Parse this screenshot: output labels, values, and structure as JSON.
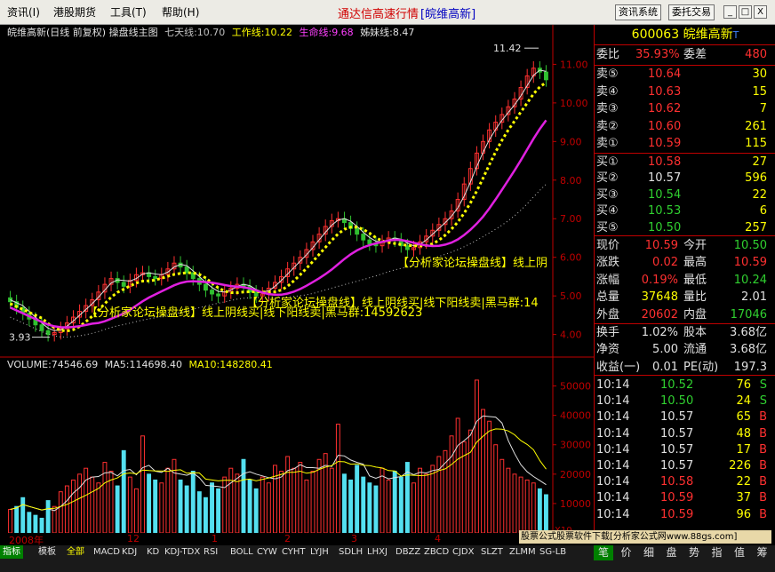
{
  "menu": {
    "items": [
      "资讯(I)",
      "港股期货",
      "工具(T)",
      "帮助(H)"
    ],
    "center_title": "通达信高速行情",
    "center_stock": "[皖维高新]",
    "btn_news": "资讯系统",
    "btn_trade": "委托交易",
    "win_min": "_",
    "win_max": "□",
    "win_close": "X"
  },
  "chart_header": {
    "name": "皖维高新(日线 前复权) 操盘线主图",
    "qitian": "七天线:10.70",
    "gongzuo": "工作线:10.22",
    "shengming": "生命线:9.68",
    "zimei": "姊妹线:8.47"
  },
  "chart_data": {
    "type": "candlestick+volume",
    "y_ticks": [
      "11.00",
      "10.00",
      "9.00",
      "8.00",
      "7.00",
      "6.00",
      "5.00",
      "4.00"
    ],
    "y_range": [
      3.6,
      11.7
    ],
    "high_label": "11.42",
    "low_label": "3.93",
    "volume_header": {
      "vol": "VOLUME:74546.69",
      "ma5": "MA5:114698.40",
      "ma10": "MA10:148280.41"
    },
    "volume_ticks": [
      "50000",
      "40000",
      "30000",
      "20000",
      "10000"
    ],
    "volume_unit": "X10",
    "volume_range": [
      0,
      55000
    ],
    "date_labels": [
      "2008年",
      "12",
      "1",
      "2",
      "3",
      "4"
    ],
    "annotation_1": "【分析家论坛操盘线】线上阴线买|线下阳线卖|黑马群:14592623",
    "annotation_2": "【分析家论坛操盘线】线上阴线买|线下阳线卖|黑马群:14",
    "annotation_3": "【分析家论坛操盘线】线上阴",
    "closes": [
      4.85,
      4.7,
      4.55,
      4.4,
      4.25,
      4.1,
      4.0,
      4.05,
      4.15,
      4.3,
      4.45,
      4.6,
      4.75,
      4.9,
      5.1,
      5.3,
      5.45,
      5.35,
      5.25,
      5.4,
      5.55,
      5.6,
      5.5,
      5.45,
      5.55,
      5.7,
      5.85,
      5.75,
      5.6,
      5.45,
      5.3,
      5.15,
      5.05,
      5.0,
      5.1,
      5.2,
      5.3,
      5.25,
      5.1,
      5.0,
      5.05,
      5.2,
      5.35,
      5.5,
      5.7,
      5.85,
      6.0,
      6.2,
      6.4,
      6.6,
      6.8,
      6.95,
      7.0,
      6.9,
      6.75,
      6.6,
      6.45,
      6.35,
      6.3,
      6.4,
      6.5,
      6.45,
      6.3,
      6.2,
      6.25,
      6.4,
      6.55,
      6.7,
      6.85,
      7.0,
      7.2,
      7.5,
      7.9,
      8.3,
      8.7,
      9.0,
      9.3,
      9.5,
      9.7,
      9.9,
      10.1,
      10.4,
      10.7,
      10.9,
      10.8,
      10.6
    ],
    "volumes": [
      8000,
      9000,
      12000,
      7000,
      6000,
      5000,
      11000,
      9000,
      14000,
      16000,
      18000,
      20000,
      22000,
      19000,
      17000,
      24000,
      21000,
      16000,
      28000,
      19000,
      15000,
      33000,
      20000,
      18000,
      17000,
      22000,
      25000,
      18000,
      16000,
      21000,
      14000,
      12000,
      17000,
      15000,
      19000,
      22000,
      20000,
      25000,
      18000,
      15000,
      19000,
      17000,
      23000,
      21000,
      26000,
      22000,
      24000,
      18000,
      21000,
      25000,
      27000,
      22000,
      37000,
      20000,
      18000,
      23000,
      19000,
      17000,
      16000,
      22000,
      18000,
      21000,
      19000,
      24000,
      17000,
      22000,
      20000,
      23000,
      26000,
      28000,
      33000,
      39000,
      31000,
      35000,
      52000,
      42000,
      38000,
      30000,
      25000,
      22000,
      20000,
      19000,
      18000,
      17000,
      15000,
      13000
    ]
  },
  "quote": {
    "code": "600063",
    "name": "皖维高新",
    "t": "T",
    "weibi_label": "委比",
    "weibi": "35.93%",
    "weicha_label": "委差",
    "weicha": "480",
    "sell": [
      {
        "label": "卖⑤",
        "price": "10.64",
        "vol": "30"
      },
      {
        "label": "卖④",
        "price": "10.63",
        "vol": "15"
      },
      {
        "label": "卖③",
        "price": "10.62",
        "vol": "7"
      },
      {
        "label": "卖②",
        "price": "10.60",
        "vol": "261"
      },
      {
        "label": "卖①",
        "price": "10.59",
        "vol": "115"
      }
    ],
    "buy": [
      {
        "label": "买①",
        "price": "10.58",
        "vol": "27"
      },
      {
        "label": "买②",
        "price": "10.57",
        "vol": "596"
      },
      {
        "label": "买③",
        "price": "10.54",
        "vol": "22"
      },
      {
        "label": "买④",
        "price": "10.53",
        "vol": "6"
      },
      {
        "label": "买⑤",
        "price": "10.50",
        "vol": "257"
      }
    ],
    "stats": [
      {
        "l1": "现价",
        "v1": "10.59",
        "l2": "今开",
        "v2": "10.50"
      },
      {
        "l1": "涨跌",
        "v1": "0.02",
        "l2": "最高",
        "v2": "10.59"
      },
      {
        "l1": "涨幅",
        "v1": "0.19%",
        "l2": "最低",
        "v2": "10.24"
      },
      {
        "l1": "总量",
        "v1": "37648",
        "l2": "量比",
        "v2": "2.01"
      },
      {
        "l1": "外盘",
        "v1": "20602",
        "l2": "内盘",
        "v2": "17046"
      }
    ],
    "stats2": [
      {
        "l1": "换手",
        "v1": "1.02%",
        "l2": "股本",
        "v2": "3.68亿"
      },
      {
        "l1": "净资",
        "v1": "5.00",
        "l2": "流通",
        "v2": "3.68亿"
      },
      {
        "l1": "收益(一)",
        "v1": "0.01",
        "l2": "PE(动)",
        "v2": "197.3"
      }
    ],
    "ticks": [
      {
        "time": "10:14",
        "price": "10.52",
        "vol": "76",
        "side": "S"
      },
      {
        "time": "10:14",
        "price": "10.50",
        "vol": "24",
        "side": "S"
      },
      {
        "time": "10:14",
        "price": "10.57",
        "vol": "65",
        "side": "B"
      },
      {
        "time": "10:14",
        "price": "10.57",
        "vol": "48",
        "side": "B"
      },
      {
        "time": "10:14",
        "price": "10.57",
        "vol": "17",
        "side": "B"
      },
      {
        "time": "10:14",
        "price": "10.57",
        "vol": "226",
        "side": "B"
      },
      {
        "time": "10:14",
        "price": "10.58",
        "vol": "22",
        "side": "B"
      },
      {
        "time": "10:14",
        "price": "10.59",
        "vol": "37",
        "side": "B"
      },
      {
        "time": "10:14",
        "price": "10.59",
        "vol": "96",
        "side": "B"
      }
    ]
  },
  "tabs": [
    "指标",
    "模板",
    "全部",
    "MACD",
    "KDJ",
    "KD",
    "KDJ-TDX",
    "RSI",
    "BOLL",
    "CYW",
    "CYHT",
    "LYJH",
    "SDLH",
    "LHXJ",
    "DBZZ",
    "ZBCD",
    "CJDX",
    "SLZT",
    "ZLMM",
    "SG-LB"
  ],
  "right_tabs": [
    "笔",
    "价",
    "细",
    "盘",
    "势",
    "指",
    "值",
    "筹"
  ],
  "promo": "股票公式股票软件下载[分析家公式网www.88gs.com]",
  "colors": {
    "up": "#ff3030",
    "down": "#30c030",
    "vol_up": "#ff3030",
    "vol_down": "#54e0f0",
    "grid": "#800000",
    "yellow": "#ffff00",
    "magenta": "#e020e0",
    "white": "#ffffff"
  }
}
